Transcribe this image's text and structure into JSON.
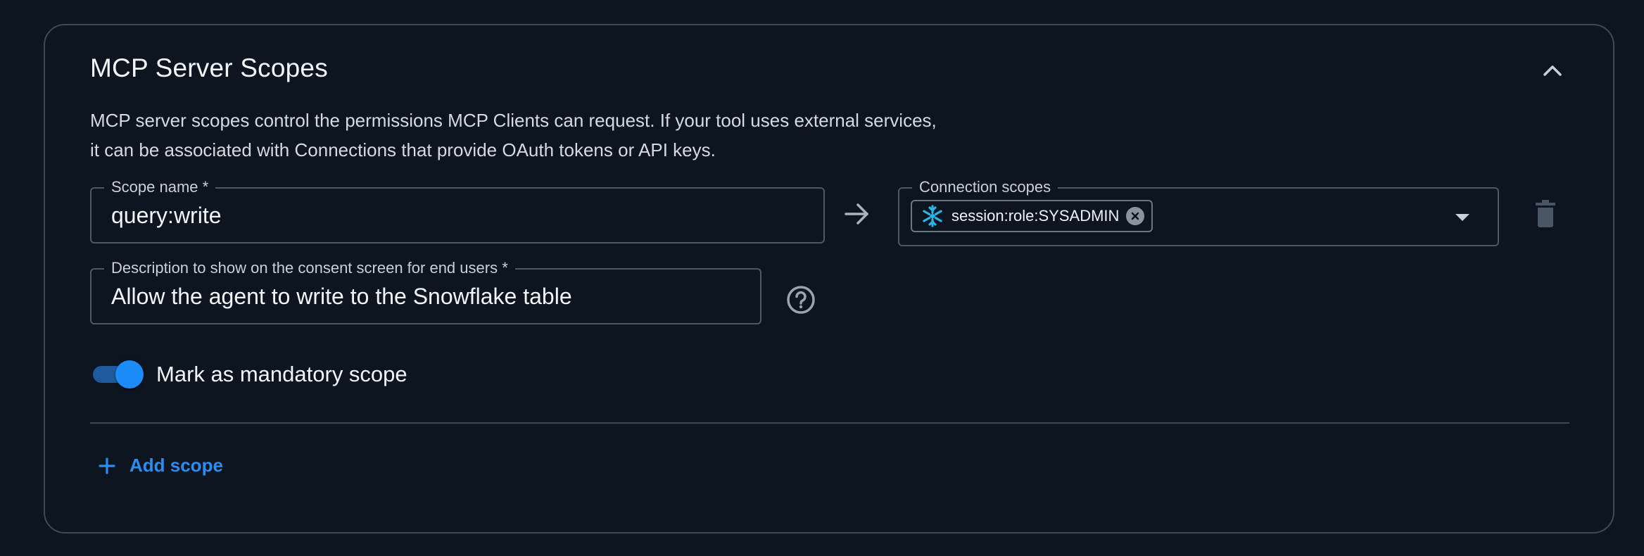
{
  "section": {
    "title": "MCP Server Scopes",
    "description_line1": "MCP server scopes control the permissions MCP Clients can request. If your tool uses external services,",
    "description_line2": "it can be associated with Connections that provide OAuth tokens or API keys."
  },
  "scope": {
    "name_label": "Scope name *",
    "name_value": "query:write",
    "connection_label": "Connection scopes",
    "connection_chip": "session:role:SYSADMIN",
    "description_label": "Description to show on the consent screen for end users *",
    "description_value": "Allow the agent to write to the Snowflake table",
    "mandatory_label": "Mark as mandatory scope",
    "mandatory_checked": true
  },
  "actions": {
    "add_scope_label": "Add scope"
  },
  "icons": {
    "collapse": "chevron-up-icon",
    "arrow": "arrow-right-icon",
    "snowflake": "snowflake-icon",
    "chip_remove": "close-circle-icon",
    "dropdown": "caret-down-icon",
    "delete": "trash-icon",
    "help": "help-circle-icon",
    "add": "plus-icon"
  },
  "colors": {
    "background": "#0d1520",
    "accent": "#1d8cf8",
    "link": "#2d8cf0",
    "border": "#3a4956",
    "snowflake": "#29b5e8"
  }
}
